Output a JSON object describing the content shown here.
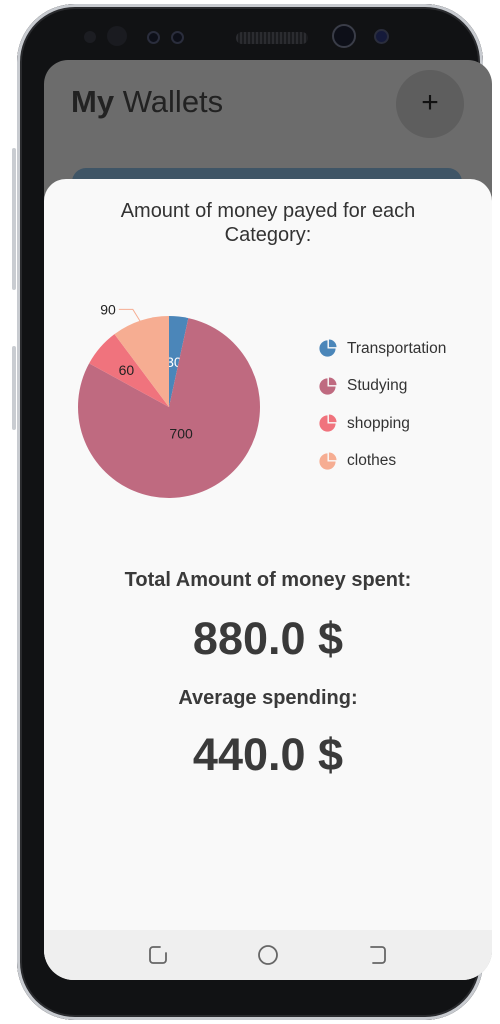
{
  "app": {
    "title_bold": "My",
    "title_rest": " Wallets",
    "add_button_label": "+"
  },
  "sheet": {
    "title": "Amount of money payed for each Category:",
    "total_label": "Total Amount of money spent:",
    "total_value": "880.0 $",
    "average_label": "Average spending:",
    "average_value": "440.0 $"
  },
  "chart_data": {
    "type": "pie",
    "title": "Amount of money payed for each Category:",
    "slices": [
      {
        "label": "Transportation",
        "value": 30,
        "color": "#4b86b9"
      },
      {
        "label": "Studying",
        "value": 700,
        "color": "#bf6a80"
      },
      {
        "label": "shopping",
        "value": 60,
        "color": "#f0737d"
      },
      {
        "label": "clothes",
        "value": 90,
        "color": "#f6ad92"
      }
    ],
    "legend_position": "right"
  },
  "nav": {
    "icons": [
      "recent-apps-icon",
      "home-icon",
      "back-icon"
    ]
  }
}
